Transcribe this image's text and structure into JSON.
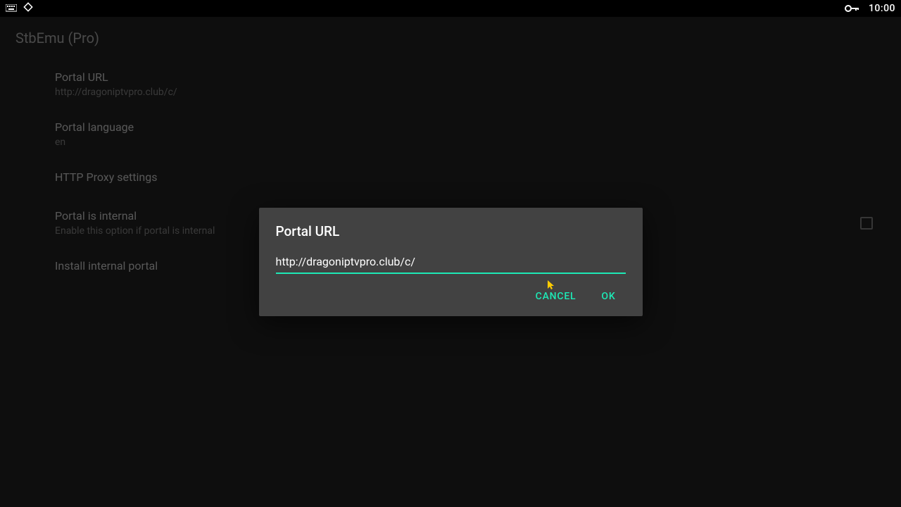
{
  "status_bar": {
    "time": "10:00"
  },
  "app": {
    "title": "StbEmu (Pro)"
  },
  "settings": {
    "portal_url": {
      "title": "Portal URL",
      "value": "http://dragoniptvpro.club/c/"
    },
    "portal_language": {
      "title": "Portal language",
      "value": "en"
    },
    "http_proxy": {
      "title": "HTTP Proxy settings"
    },
    "portal_internal": {
      "title": "Portal is internal",
      "sub": "Enable this option if portal is internal"
    },
    "install_internal": {
      "title": "Install internal portal"
    }
  },
  "dialog": {
    "title": "Portal URL",
    "input_value": "http://dragoniptvpro.club/c/",
    "cancel": "CANCEL",
    "ok": "OK"
  }
}
